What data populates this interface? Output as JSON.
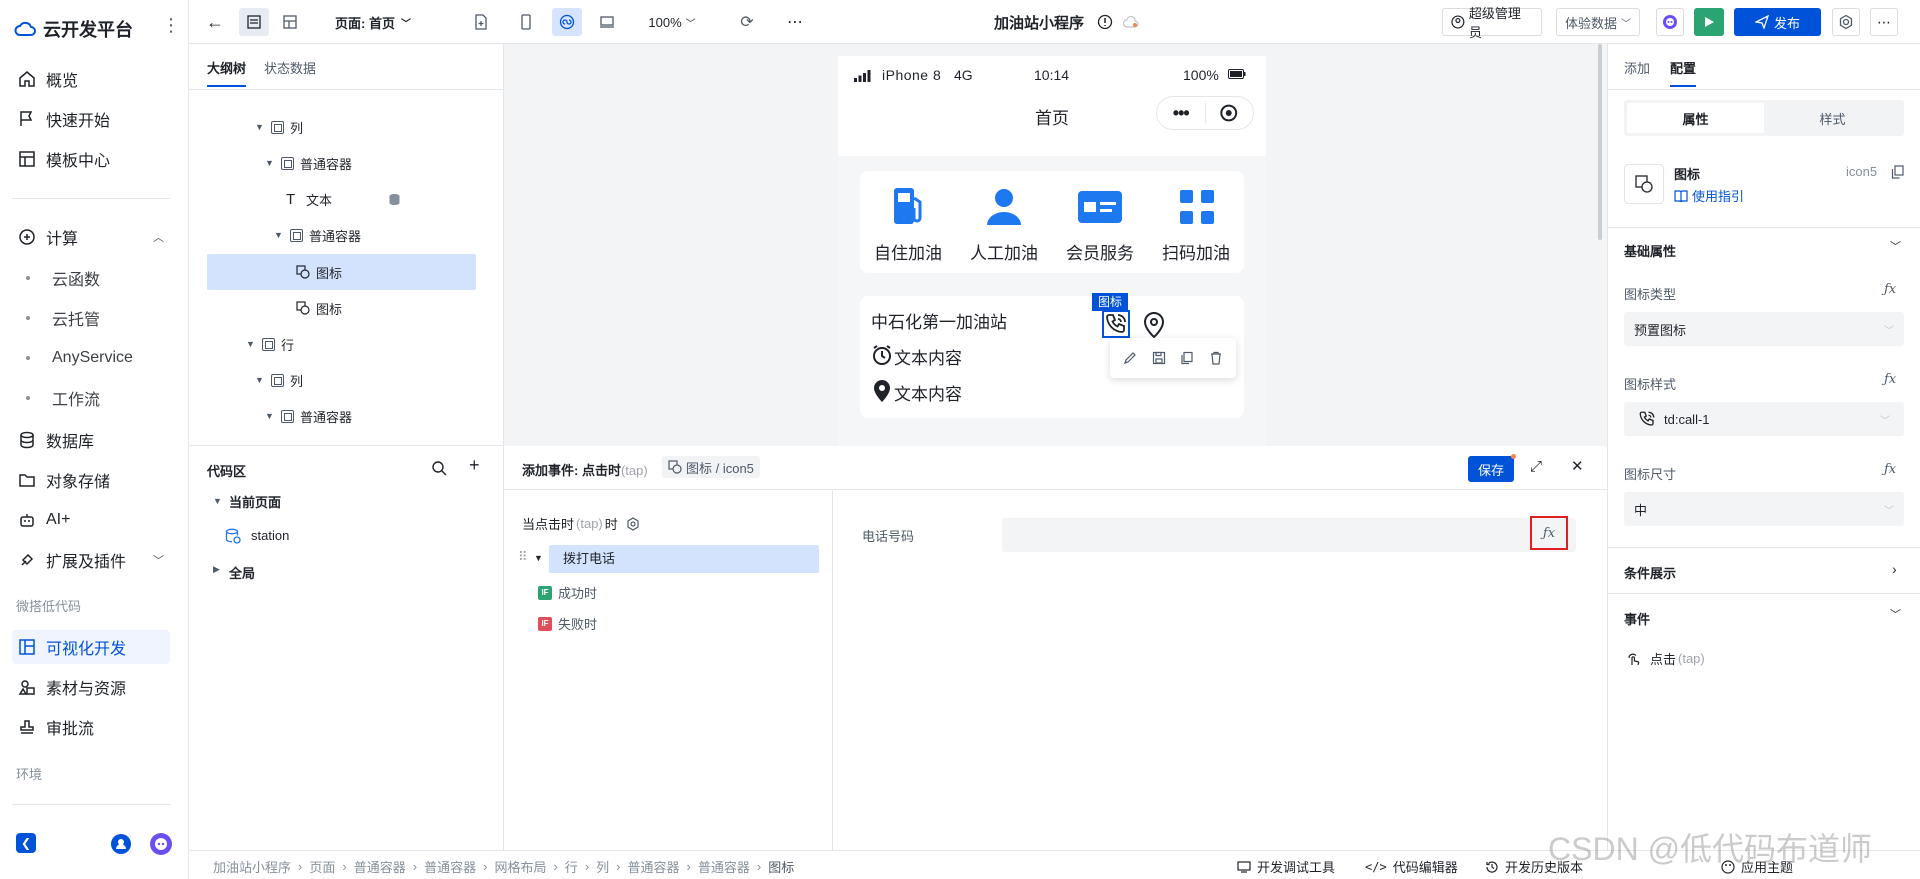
{
  "app": {
    "name": "云开发平台"
  },
  "sidebar": {
    "items": [
      {
        "label": "概览",
        "icon": "home-icon"
      },
      {
        "label": "快速开始",
        "icon": "flag-icon"
      },
      {
        "label": "模板中心",
        "icon": "template-icon"
      }
    ],
    "compute": {
      "label": "计算",
      "children": [
        "云函数",
        "云托管",
        "AnyService",
        "工作流"
      ]
    },
    "items2": [
      {
        "label": "数据库",
        "icon": "database-icon"
      },
      {
        "label": "对象存储",
        "icon": "folder-icon"
      },
      {
        "label": "AI+",
        "icon": "robot-icon"
      },
      {
        "label": "扩展及插件",
        "icon": "plugin-icon"
      }
    ],
    "section_lowcode": "微搭低代码",
    "items3": [
      {
        "label": "可视化开发",
        "icon": "visual-dev-icon"
      },
      {
        "label": "素材与资源",
        "icon": "assets-icon"
      },
      {
        "label": "审批流",
        "icon": "approval-icon"
      }
    ],
    "section_env": "环境"
  },
  "topbar": {
    "page_label": "页面: 首页",
    "zoom": "100%",
    "app_title": "加油站小程序",
    "user": "超级管理员",
    "data_mode": "体验数据",
    "publish": "发布"
  },
  "tree": {
    "tabs": [
      "大纲树",
      "状态数据"
    ],
    "nodes": [
      {
        "label": "列"
      },
      {
        "label": "普通容器"
      },
      {
        "label": "文本"
      },
      {
        "label": "普通容器"
      },
      {
        "label": "图标"
      },
      {
        "label": "图标"
      },
      {
        "label": "行"
      },
      {
        "label": "列"
      },
      {
        "label": "普通容器"
      }
    ]
  },
  "phone": {
    "carrier": "iPhone 8",
    "network": "4G",
    "time": "10:14",
    "battery": "100%",
    "page_title": "首页",
    "services": [
      "自住加油",
      "人工加油",
      "会员服务",
      "扫码加油"
    ],
    "station_name": "中石化第一加油站",
    "selected_tag": "图标",
    "line1": "文本内容",
    "line2": "文本内容"
  },
  "codearea": {
    "title": "代码区",
    "current_page": "当前页面",
    "station": "station",
    "global": "全局"
  },
  "event": {
    "title": "添加事件: 点击时",
    "title_tap": "(tap)",
    "target": "图标 / icon5",
    "save": "保存",
    "trigger_label": "当点击时",
    "trigger_tap": "(tap)",
    "trigger_suffix": "时",
    "action": "拨打电话",
    "success": "成功时",
    "fail": "失败时",
    "field_label": "电话号码",
    "field_value": ""
  },
  "right": {
    "tabs": [
      "添加",
      "配置"
    ],
    "seg": [
      "属性",
      "样式"
    ],
    "comp_name": "图标",
    "comp_id": "icon5",
    "guide": "使用指引",
    "basic": "基础属性",
    "icon_type_label": "图标类型",
    "icon_type_value": "预置图标",
    "icon_style_label": "图标样式",
    "icon_style_value": "td:call-1",
    "icon_size_label": "图标尺寸",
    "icon_size_value": "中",
    "cond": "条件展示",
    "events": "事件",
    "event_item": "点击",
    "event_item_tap": "(tap)"
  },
  "status": {
    "breadcrumb": [
      "加油站小程序",
      "页面",
      "普通容器",
      "普通容器",
      "网格布局",
      "行",
      "列",
      "普通容器",
      "普通容器",
      "图标"
    ],
    "tools": [
      "开发调试工具",
      "代码编辑器",
      "开发历史版本",
      "应用主题"
    ],
    "watermark": "CSDN @低代码布道师"
  },
  "colors": {
    "accent": "#0052d9",
    "publish": "#0052d9",
    "run": "#2ba471",
    "highlight_box": "#e02020"
  }
}
